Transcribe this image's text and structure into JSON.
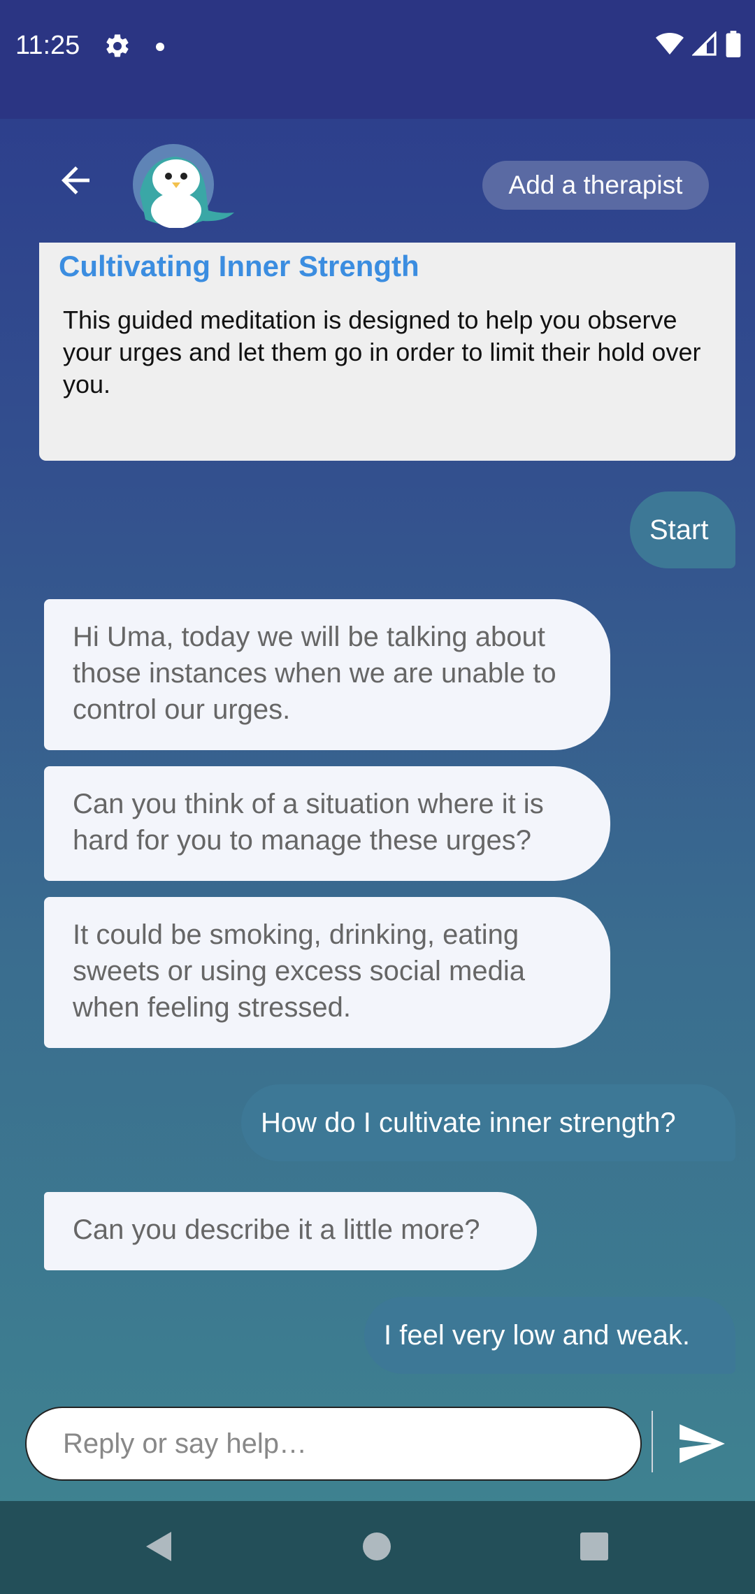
{
  "status_bar": {
    "time": "11:25"
  },
  "header": {
    "add_therapist_label": "Add a therapist"
  },
  "card": {
    "title": "Cultivating Inner Strength",
    "description": "This guided meditation is designed to help you observe your urges and let them go in order to limit their hold over you."
  },
  "messages": [
    {
      "from": "user",
      "text": "Start"
    },
    {
      "from": "bot",
      "text": "Hi Uma, today we will be talking about those instances when we are unable to control our urges."
    },
    {
      "from": "bot",
      "text": "Can you think of a situation where it is hard for you to manage these urges?"
    },
    {
      "from": "bot",
      "text": "It could be smoking, drinking, eating sweets or using excess social media when feeling stressed."
    },
    {
      "from": "user",
      "text": "How do I cultivate inner strength?"
    },
    {
      "from": "bot",
      "text": "Can you describe it a little more?"
    },
    {
      "from": "user",
      "text": "I feel very low and weak."
    }
  ],
  "composer": {
    "placeholder": "Reply or say help…"
  },
  "colors": {
    "status_bar_bg": "#2b3583",
    "user_bubble": "#3d7896",
    "bot_bubble": "#f3f5fb",
    "card_title": "#3b8de0",
    "therapist_button": "#5a6aa3",
    "nav_bar": "#234f59"
  },
  "icons": [
    "settings-icon",
    "notification-dot-icon",
    "wifi-icon",
    "signal-icon",
    "battery-icon",
    "back-arrow-icon",
    "penguin-avatar-icon",
    "send-icon",
    "nav-back-icon",
    "nav-home-icon",
    "nav-recents-icon"
  ]
}
